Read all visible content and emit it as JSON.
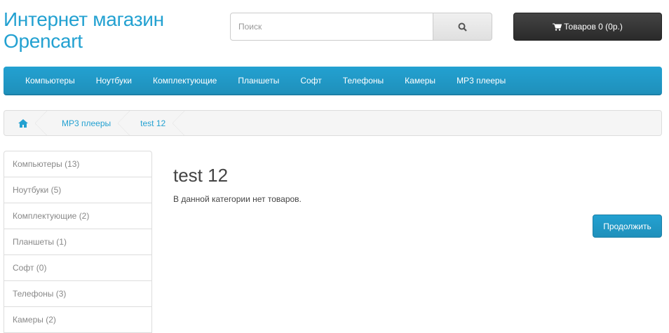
{
  "header": {
    "logo_line1": "Интернет магазин",
    "logo_line2": "Opencart",
    "search_placeholder": "Поиск",
    "cart_label": "Товаров 0 (0р.)"
  },
  "nav": [
    "Компьютеры",
    "Ноутбуки",
    "Комплектующие",
    "Планшеты",
    "Софт",
    "Телефоны",
    "Камеры",
    "MP3 плееры"
  ],
  "breadcrumb": [
    "MP3 плееры",
    "test 12"
  ],
  "sidebar": [
    "Компьютеры (13)",
    "Ноутбуки (5)",
    "Комплектующие (2)",
    "Планшеты (1)",
    "Софт (0)",
    "Телефоны (3)",
    "Камеры (2)"
  ],
  "main": {
    "title": "test 12",
    "empty_text": "В данной категории нет товаров.",
    "continue_label": "Продолжить"
  },
  "colors": {
    "accent": "#23a1d1",
    "cart_bg": "#333333"
  }
}
